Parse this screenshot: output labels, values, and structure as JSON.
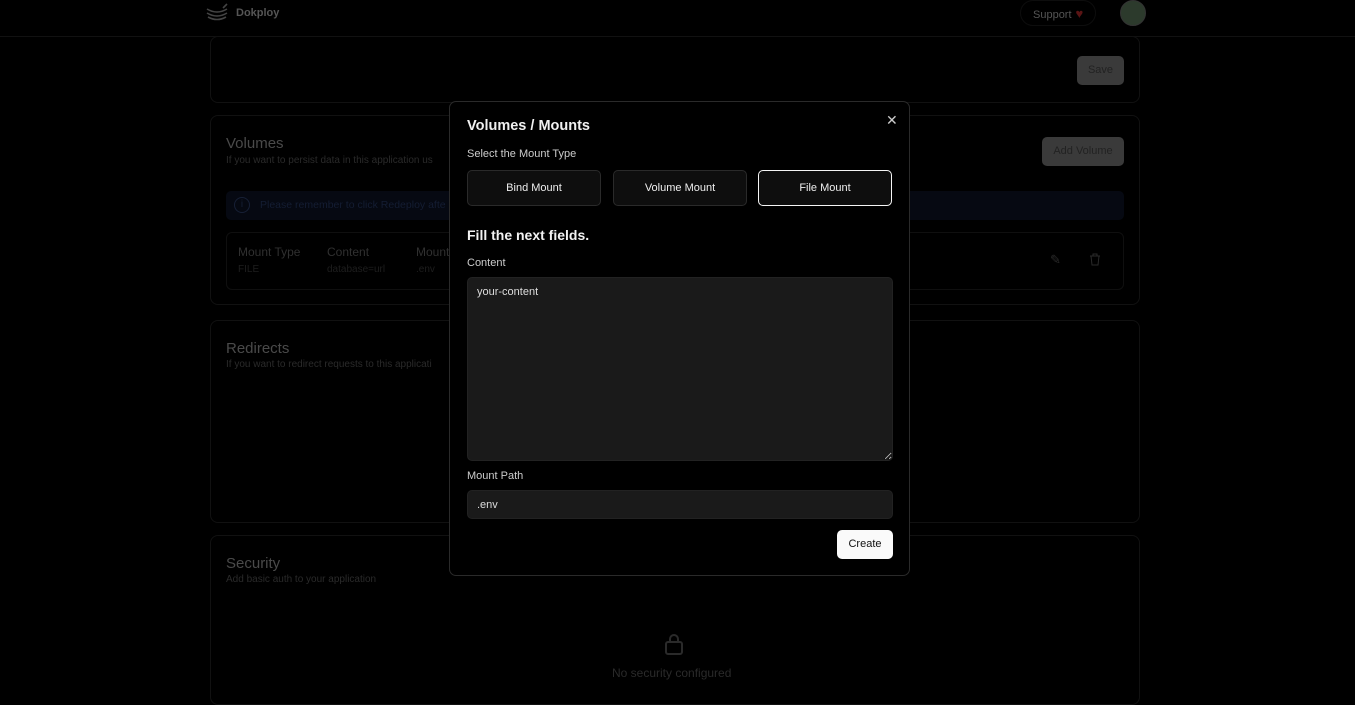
{
  "header": {
    "brand": "Dokploy",
    "support": "Support"
  },
  "general": {
    "save": "Save"
  },
  "volumes": {
    "title": "Volumes",
    "subtitle": "If you want to persist data in this application us",
    "add": "Add Volume",
    "alert": "Please remember to click Redeploy afte",
    "columns": [
      "Mount Type",
      "Content",
      "Mount"
    ],
    "row": [
      "FILE",
      "database=url",
      ".env"
    ]
  },
  "redirects": {
    "title": "Redirects",
    "subtitle": "If you want to redirect requests to this applicati"
  },
  "security": {
    "title": "Security",
    "subtitle": "Add basic auth to your application",
    "empty": "No security configured"
  },
  "modal": {
    "title": "Volumes / Mounts",
    "select_label": "Select the Mount Type",
    "types": [
      "Bind Mount",
      "Volume Mount",
      "File Mount"
    ],
    "selected": "File Mount",
    "fill": "Fill the next fields.",
    "content_label": "Content",
    "content_value": "your-content",
    "path_label": "Mount Path",
    "path_value": ".env",
    "create": "Create"
  }
}
